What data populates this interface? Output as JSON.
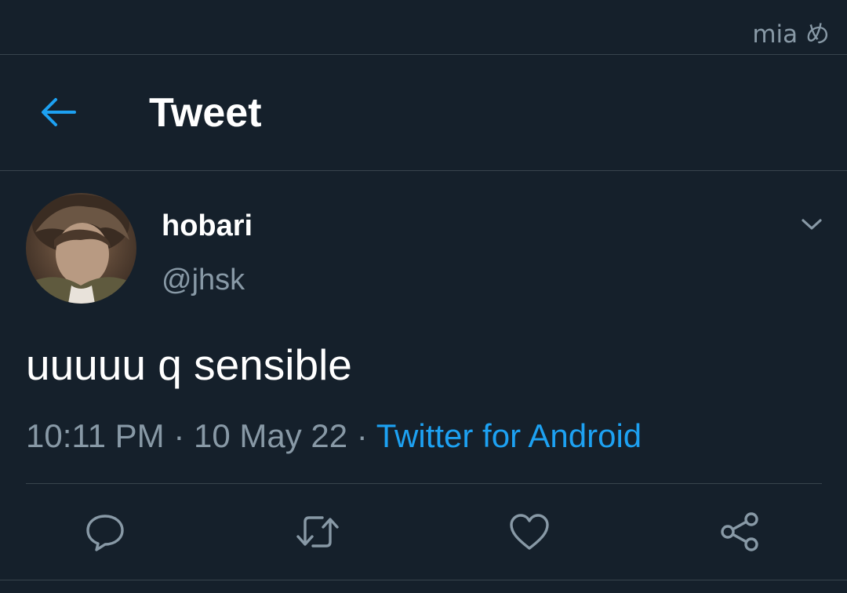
{
  "watermark": "mia め",
  "header": {
    "title": "Tweet",
    "back_icon": "arrow-left-icon"
  },
  "tweet": {
    "display_name": "hobari",
    "handle": "@jhsk",
    "text": "uuuuu q sensible",
    "time": "10:11 PM",
    "separator": " · ",
    "date": "10 May 22",
    "source": "Twitter for Android"
  },
  "actions": [
    {
      "name": "reply",
      "icon": "speech-bubble-icon"
    },
    {
      "name": "retweet",
      "icon": "retweet-arrows-icon"
    },
    {
      "name": "like",
      "icon": "heart-icon"
    },
    {
      "name": "share",
      "icon": "share-nodes-icon"
    }
  ],
  "colors": {
    "background": "#15202b",
    "accent": "#1da1f2",
    "secondary_text": "#8899a6",
    "divider": "#38444d"
  }
}
